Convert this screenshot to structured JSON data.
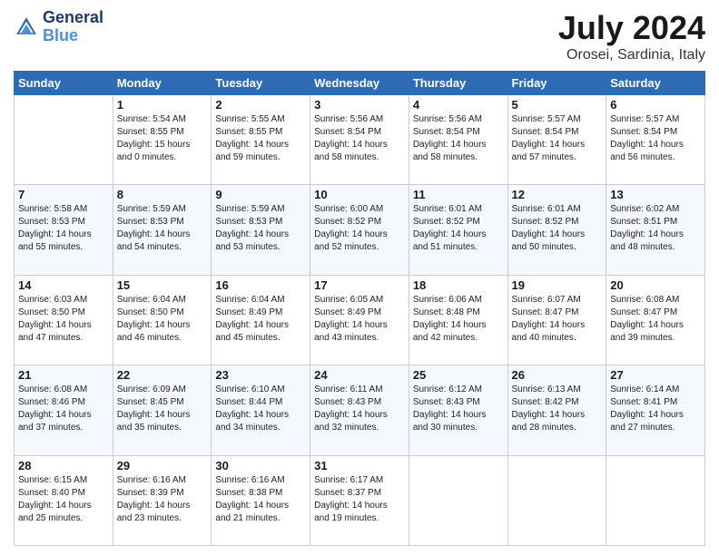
{
  "logo": {
    "line1": "General",
    "line2": "Blue"
  },
  "title": "July 2024",
  "subtitle": "Orosei, Sardinia, Italy",
  "days_header": [
    "Sunday",
    "Monday",
    "Tuesday",
    "Wednesday",
    "Thursday",
    "Friday",
    "Saturday"
  ],
  "weeks": [
    [
      {
        "day": "",
        "sunrise": "",
        "sunset": "",
        "daylight": ""
      },
      {
        "day": "1",
        "sunrise": "Sunrise: 5:54 AM",
        "sunset": "Sunset: 8:55 PM",
        "daylight": "Daylight: 15 hours and 0 minutes."
      },
      {
        "day": "2",
        "sunrise": "Sunrise: 5:55 AM",
        "sunset": "Sunset: 8:55 PM",
        "daylight": "Daylight: 14 hours and 59 minutes."
      },
      {
        "day": "3",
        "sunrise": "Sunrise: 5:56 AM",
        "sunset": "Sunset: 8:54 PM",
        "daylight": "Daylight: 14 hours and 58 minutes."
      },
      {
        "day": "4",
        "sunrise": "Sunrise: 5:56 AM",
        "sunset": "Sunset: 8:54 PM",
        "daylight": "Daylight: 14 hours and 58 minutes."
      },
      {
        "day": "5",
        "sunrise": "Sunrise: 5:57 AM",
        "sunset": "Sunset: 8:54 PM",
        "daylight": "Daylight: 14 hours and 57 minutes."
      },
      {
        "day": "6",
        "sunrise": "Sunrise: 5:57 AM",
        "sunset": "Sunset: 8:54 PM",
        "daylight": "Daylight: 14 hours and 56 minutes."
      }
    ],
    [
      {
        "day": "7",
        "sunrise": "Sunrise: 5:58 AM",
        "sunset": "Sunset: 8:53 PM",
        "daylight": "Daylight: 14 hours and 55 minutes."
      },
      {
        "day": "8",
        "sunrise": "Sunrise: 5:59 AM",
        "sunset": "Sunset: 8:53 PM",
        "daylight": "Daylight: 14 hours and 54 minutes."
      },
      {
        "day": "9",
        "sunrise": "Sunrise: 5:59 AM",
        "sunset": "Sunset: 8:53 PM",
        "daylight": "Daylight: 14 hours and 53 minutes."
      },
      {
        "day": "10",
        "sunrise": "Sunrise: 6:00 AM",
        "sunset": "Sunset: 8:52 PM",
        "daylight": "Daylight: 14 hours and 52 minutes."
      },
      {
        "day": "11",
        "sunrise": "Sunrise: 6:01 AM",
        "sunset": "Sunset: 8:52 PM",
        "daylight": "Daylight: 14 hours and 51 minutes."
      },
      {
        "day": "12",
        "sunrise": "Sunrise: 6:01 AM",
        "sunset": "Sunset: 8:52 PM",
        "daylight": "Daylight: 14 hours and 50 minutes."
      },
      {
        "day": "13",
        "sunrise": "Sunrise: 6:02 AM",
        "sunset": "Sunset: 8:51 PM",
        "daylight": "Daylight: 14 hours and 48 minutes."
      }
    ],
    [
      {
        "day": "14",
        "sunrise": "Sunrise: 6:03 AM",
        "sunset": "Sunset: 8:50 PM",
        "daylight": "Daylight: 14 hours and 47 minutes."
      },
      {
        "day": "15",
        "sunrise": "Sunrise: 6:04 AM",
        "sunset": "Sunset: 8:50 PM",
        "daylight": "Daylight: 14 hours and 46 minutes."
      },
      {
        "day": "16",
        "sunrise": "Sunrise: 6:04 AM",
        "sunset": "Sunset: 8:49 PM",
        "daylight": "Daylight: 14 hours and 45 minutes."
      },
      {
        "day": "17",
        "sunrise": "Sunrise: 6:05 AM",
        "sunset": "Sunset: 8:49 PM",
        "daylight": "Daylight: 14 hours and 43 minutes."
      },
      {
        "day": "18",
        "sunrise": "Sunrise: 6:06 AM",
        "sunset": "Sunset: 8:48 PM",
        "daylight": "Daylight: 14 hours and 42 minutes."
      },
      {
        "day": "19",
        "sunrise": "Sunrise: 6:07 AM",
        "sunset": "Sunset: 8:47 PM",
        "daylight": "Daylight: 14 hours and 40 minutes."
      },
      {
        "day": "20",
        "sunrise": "Sunrise: 6:08 AM",
        "sunset": "Sunset: 8:47 PM",
        "daylight": "Daylight: 14 hours and 39 minutes."
      }
    ],
    [
      {
        "day": "21",
        "sunrise": "Sunrise: 6:08 AM",
        "sunset": "Sunset: 8:46 PM",
        "daylight": "Daylight: 14 hours and 37 minutes."
      },
      {
        "day": "22",
        "sunrise": "Sunrise: 6:09 AM",
        "sunset": "Sunset: 8:45 PM",
        "daylight": "Daylight: 14 hours and 35 minutes."
      },
      {
        "day": "23",
        "sunrise": "Sunrise: 6:10 AM",
        "sunset": "Sunset: 8:44 PM",
        "daylight": "Daylight: 14 hours and 34 minutes."
      },
      {
        "day": "24",
        "sunrise": "Sunrise: 6:11 AM",
        "sunset": "Sunset: 8:43 PM",
        "daylight": "Daylight: 14 hours and 32 minutes."
      },
      {
        "day": "25",
        "sunrise": "Sunrise: 6:12 AM",
        "sunset": "Sunset: 8:43 PM",
        "daylight": "Daylight: 14 hours and 30 minutes."
      },
      {
        "day": "26",
        "sunrise": "Sunrise: 6:13 AM",
        "sunset": "Sunset: 8:42 PM",
        "daylight": "Daylight: 14 hours and 28 minutes."
      },
      {
        "day": "27",
        "sunrise": "Sunrise: 6:14 AM",
        "sunset": "Sunset: 8:41 PM",
        "daylight": "Daylight: 14 hours and 27 minutes."
      }
    ],
    [
      {
        "day": "28",
        "sunrise": "Sunrise: 6:15 AM",
        "sunset": "Sunset: 8:40 PM",
        "daylight": "Daylight: 14 hours and 25 minutes."
      },
      {
        "day": "29",
        "sunrise": "Sunrise: 6:16 AM",
        "sunset": "Sunset: 8:39 PM",
        "daylight": "Daylight: 14 hours and 23 minutes."
      },
      {
        "day": "30",
        "sunrise": "Sunrise: 6:16 AM",
        "sunset": "Sunset: 8:38 PM",
        "daylight": "Daylight: 14 hours and 21 minutes."
      },
      {
        "day": "31",
        "sunrise": "Sunrise: 6:17 AM",
        "sunset": "Sunset: 8:37 PM",
        "daylight": "Daylight: 14 hours and 19 minutes."
      },
      {
        "day": "",
        "sunrise": "",
        "sunset": "",
        "daylight": ""
      },
      {
        "day": "",
        "sunrise": "",
        "sunset": "",
        "daylight": ""
      },
      {
        "day": "",
        "sunrise": "",
        "sunset": "",
        "daylight": ""
      }
    ]
  ]
}
